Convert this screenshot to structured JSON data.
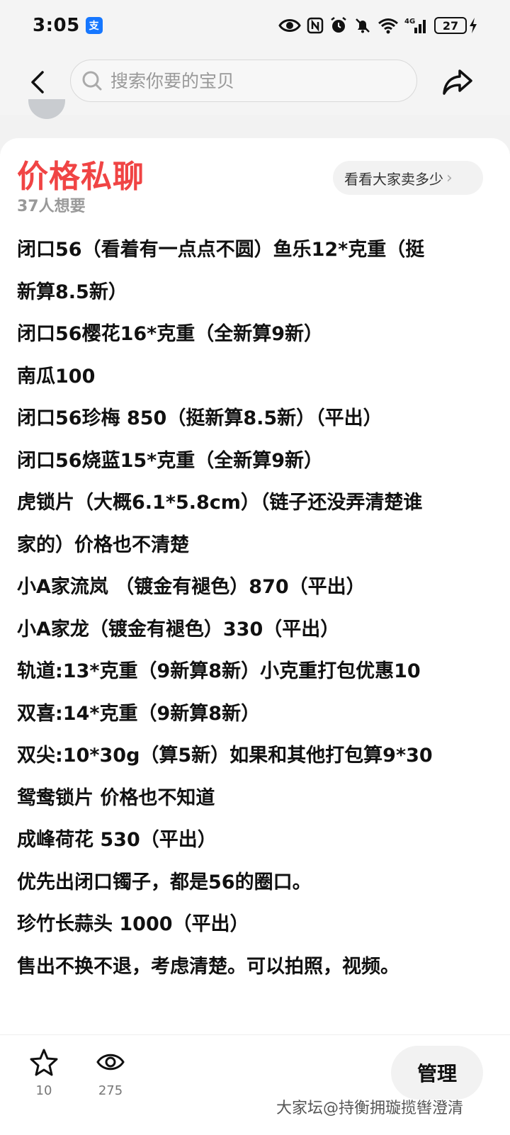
{
  "status_bar": {
    "time": "3:05",
    "app_badge": "支",
    "network": "4G",
    "battery": "27"
  },
  "search": {
    "placeholder": "搜索你要的宝贝"
  },
  "listing": {
    "price_label": "价格私聊",
    "want_count": "37人想要",
    "compare_label": "看看大家卖多少",
    "description_lines": [
      "闭口56（看着有一点点不圆）鱼乐12*克重（挺",
      "新算8.5新）",
      "闭口56樱花16*克重（全新算9新）",
      "南瓜100",
      "闭口56珍梅 850（挺新算8.5新）（平出）",
      "闭口56烧蓝15*克重（全新算9新）",
      "虎锁片（大概6.1*5.8cm）（链子还没弄清楚谁",
      "家的）价格也不清楚",
      "小A家流岚 （镀金有褪色）870（平出）",
      "小A家龙（镀金有褪色）330（平出）",
      "轨道:13*克重（9新算8新）小克重打包优惠10",
      "双喜:14*克重（9新算8新）",
      "双尖:10*30g（算5新）如果和其他打包算9*30",
      "鸳鸯锁片 价格也不知道",
      "成峰荷花  530（平出）",
      "优先出闭口镯子，都是56的圈口。",
      "珍竹长蒜头  1000（平出）",
      "售出不换不退，考虑清楚。可以拍照，视频。"
    ]
  },
  "bottom_bar": {
    "favorites_count": "10",
    "views_count": "275",
    "manage_label": "管理"
  },
  "watermark": "大家坛@持衡拥璇揽辔澄清",
  "colors": {
    "price": "#f04444",
    "alipay_blue": "#1677ff"
  }
}
